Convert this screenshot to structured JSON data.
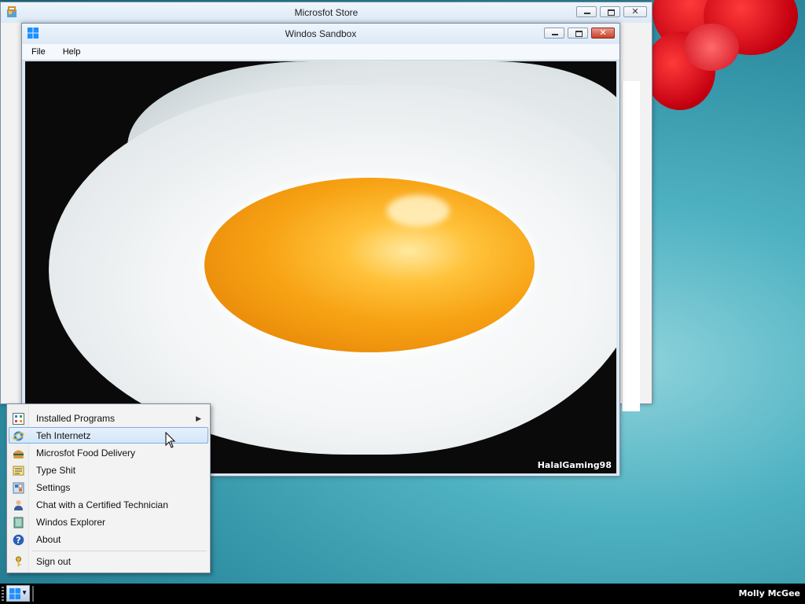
{
  "store_window": {
    "title": "Microsfot Store"
  },
  "sandbox_window": {
    "title": "Windos Sandbox",
    "menu": [
      "File",
      "Help"
    ],
    "watermark": "HalalGaming98"
  },
  "start_menu": {
    "items": [
      {
        "label": "Installed Programs",
        "icon": "programs-icon",
        "submenu": true
      },
      {
        "label": "Teh Internetz",
        "icon": "internet-explorer-icon",
        "highlighted": true
      },
      {
        "label": "Microsfot Food Delivery",
        "icon": "burger-icon"
      },
      {
        "label": "Type Shit",
        "icon": "notepad-icon"
      },
      {
        "label": "Settings",
        "icon": "settings-icon"
      },
      {
        "label": "Chat with a Certified Technician",
        "icon": "technician-icon"
      },
      {
        "label": "Windos Explorer",
        "icon": "explorer-icon"
      },
      {
        "label": "About",
        "icon": "help-icon"
      },
      {
        "label": "Sign out",
        "icon": "key-icon"
      }
    ]
  },
  "taskbar": {
    "user_name": "Molly McGee"
  },
  "colors": {
    "highlight": "#d2e6f8",
    "close_red": "#c9402b"
  }
}
